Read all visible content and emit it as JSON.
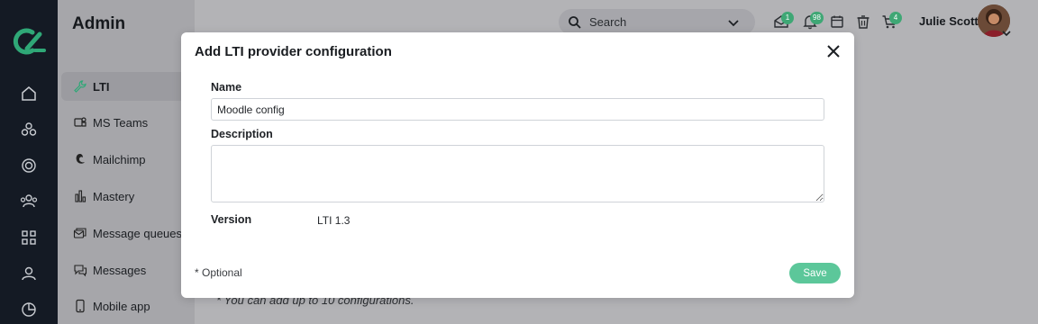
{
  "app": {
    "section_title": "Admin"
  },
  "sidebar": {
    "items": [
      {
        "label": "LTI",
        "icon": "wrench-icon",
        "active": true
      },
      {
        "label": "MS Teams",
        "icon": "teams-icon"
      },
      {
        "label": "Mailchimp",
        "icon": "mailchimp-icon"
      },
      {
        "label": "Mastery",
        "icon": "bar-chart-icon"
      },
      {
        "label": "Message queues",
        "icon": "queue-icon"
      },
      {
        "label": "Messages",
        "icon": "messages-icon"
      },
      {
        "label": "Mobile app",
        "icon": "mobile-icon"
      }
    ]
  },
  "rail": {
    "icons": [
      "home-icon",
      "groups-icon",
      "target-icon",
      "users-icon",
      "apps-icon",
      "profile-icon",
      "analytics-icon"
    ]
  },
  "topbar": {
    "search_placeholder": "Search",
    "badges": {
      "inbox": "1",
      "notifications": "98",
      "cart": "4"
    },
    "user_name": "Julie Scott"
  },
  "background": {
    "footnote": "* You can add up to 10 configurations."
  },
  "modal": {
    "title": "Add LTI provider configuration",
    "name_label": "Name",
    "name_value": "Moodle config",
    "description_label": "Description",
    "description_value": "",
    "version_label": "Version",
    "version_value": "LTI 1.3",
    "optional_note": "* Optional",
    "save_label": "Save"
  },
  "colors": {
    "rail_bg": "#141a24",
    "accent": "#3fa775",
    "save_bg": "#5cc79a"
  }
}
